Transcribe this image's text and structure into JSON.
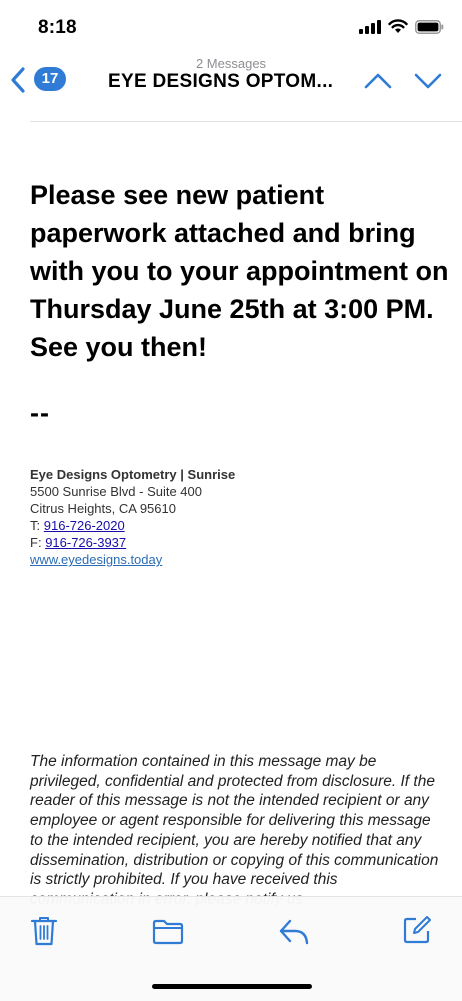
{
  "status_bar": {
    "time": "8:18"
  },
  "nav": {
    "back_count": "17",
    "message_count": "2 Messages",
    "title": "EYE DESIGNS OPTOM..."
  },
  "email": {
    "body": "Please see new patient paperwork attached and bring with you to your appointment on Thursday June 25th at 3:00 PM.  See you then!",
    "separator": "--",
    "signature": {
      "name": "Eye Designs Optometry | Sunrise",
      "address1": "5500 Sunrise Blvd - Suite 400",
      "address2": "Citrus Heights, CA 95610",
      "phone_label": "T:",
      "phone": "916-726-2020",
      "fax_label": "F:",
      "fax": "916-726-3937",
      "website": "www.eyedesigns.today"
    },
    "disclaimer": "The information contained in this message may be privileged, confidential and protected from disclosure.  If the reader of this message is not the intended recipient or any employee or agent responsible for delivering this message to the intended recipient, you are hereby notified that any dissemination, distribution or copying of this communication is strictly prohibited.  If you have received this communication in error, please notify us"
  },
  "toolbar": {
    "icons": [
      "trash-icon",
      "folder-icon",
      "reply-icon",
      "compose-icon"
    ]
  },
  "colors": {
    "accent": "#2f7bd6",
    "link": "#1a0dab"
  }
}
